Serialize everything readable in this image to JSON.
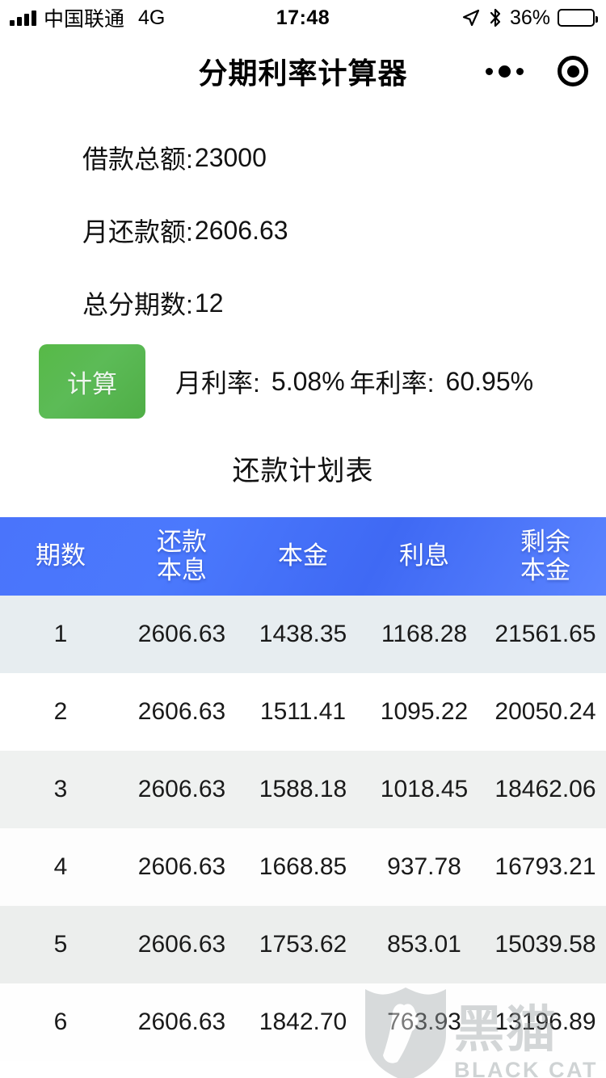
{
  "status_bar": {
    "carrier": "中国联通",
    "network": "4G",
    "time": "17:48",
    "battery_percent": "36%",
    "battery_level": 36,
    "icons": [
      "signal-bars-icon",
      "location-arrow-icon",
      "bluetooth-icon",
      "battery-icon"
    ]
  },
  "nav": {
    "title": "分期利率计算器",
    "more_icon": "more-dots-icon",
    "close_icon": "target-circle-icon"
  },
  "form": {
    "fields": [
      {
        "label": "借款总额:",
        "value": "23000"
      },
      {
        "label": "月还款额:",
        "value": "2606.63"
      },
      {
        "label": "总分期数:",
        "value": "12"
      }
    ]
  },
  "action": {
    "calculate_label": "计算",
    "calculate_color": "#57b947",
    "monthly_rate_label": "月利率:",
    "monthly_rate_value": "5.08%",
    "annual_rate_label": "年利率:",
    "annual_rate_value": "60.95%"
  },
  "schedule": {
    "title": "还款计划表",
    "header_color": "#4169f5",
    "columns": [
      {
        "line1": "期数",
        "line2": ""
      },
      {
        "line1": "还款",
        "line2": "本息"
      },
      {
        "line1": "本金",
        "line2": ""
      },
      {
        "line1": "利息",
        "line2": ""
      },
      {
        "line1": "剩余",
        "line2": "本金"
      }
    ],
    "rows": [
      {
        "period": "1",
        "payment": "2606.63",
        "principal": "1438.35",
        "interest": "1168.28",
        "remaining": "21561.65"
      },
      {
        "period": "2",
        "payment": "2606.63",
        "principal": "1511.41",
        "interest": "1095.22",
        "remaining": "20050.24"
      },
      {
        "period": "3",
        "payment": "2606.63",
        "principal": "1588.18",
        "interest": "1018.45",
        "remaining": "18462.06"
      },
      {
        "period": "4",
        "payment": "2606.63",
        "principal": "1668.85",
        "interest": "937.78",
        "remaining": "16793.21"
      },
      {
        "period": "5",
        "payment": "2606.63",
        "principal": "1753.62",
        "interest": "853.01",
        "remaining": "15039.58"
      },
      {
        "period": "6",
        "payment": "2606.63",
        "principal": "1842.70",
        "interest": "763.93",
        "remaining": "13196.89"
      }
    ]
  },
  "watermark": {
    "cn": "黑猫",
    "en": "BLACK CAT",
    "icon": "shield-cat-icon"
  }
}
